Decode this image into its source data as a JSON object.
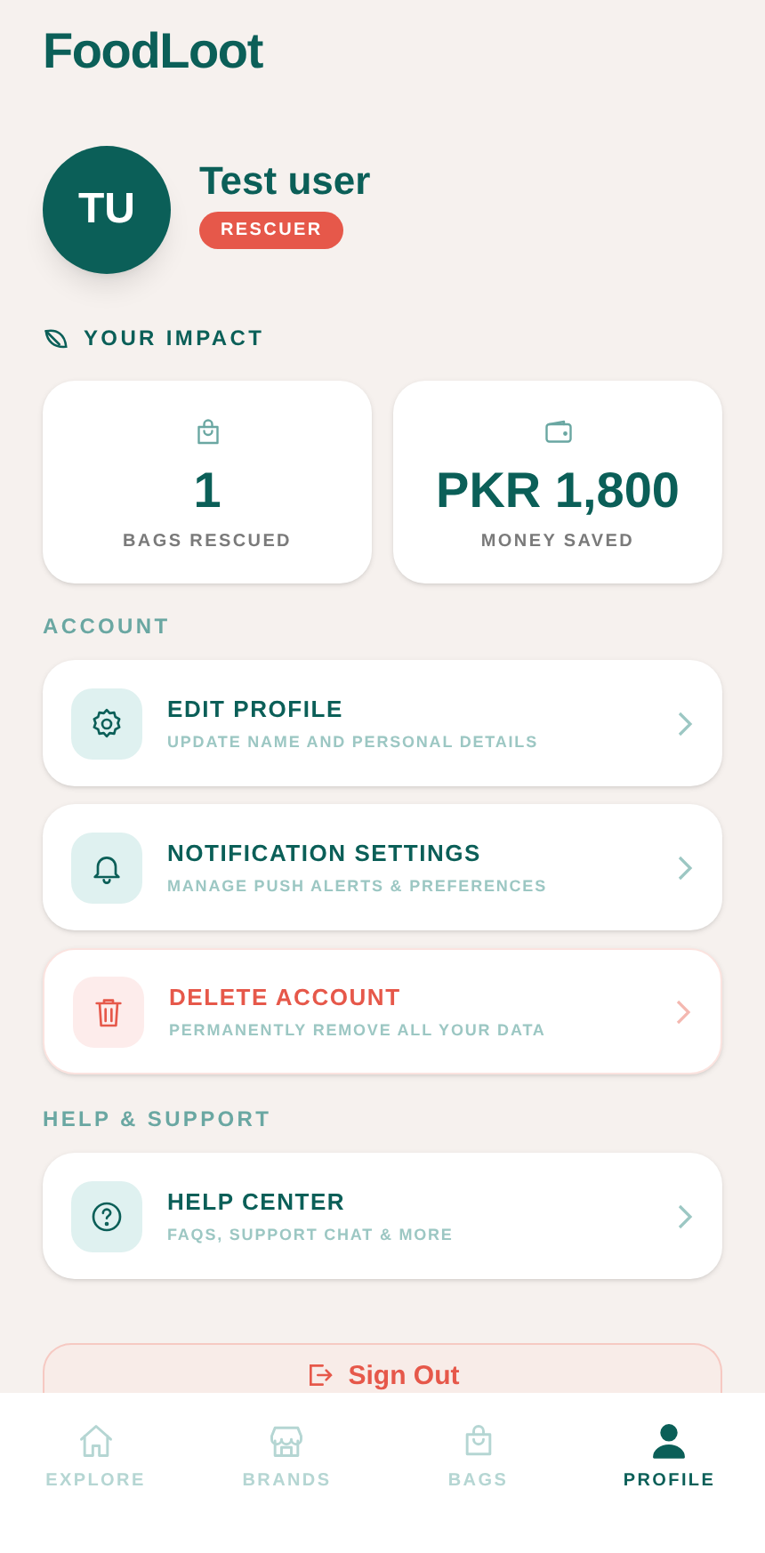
{
  "app_title": "FoodLoot",
  "profile": {
    "initials": "TU",
    "name": "Test user",
    "badge": "RESCUER"
  },
  "impact": {
    "title": "YOUR IMPACT",
    "stats": [
      {
        "value": "1",
        "label": "BAGS RESCUED"
      },
      {
        "value": "PKR 1,800",
        "label": "MONEY SAVED"
      }
    ]
  },
  "sections": [
    {
      "title": "ACCOUNT",
      "items": [
        {
          "kind": "normal",
          "title": "EDIT PROFILE",
          "subtitle": "UPDATE NAME AND PERSONAL DETAILS"
        },
        {
          "kind": "normal",
          "title": "NOTIFICATION SETTINGS",
          "subtitle": "MANAGE PUSH ALERTS & PREFERENCES"
        },
        {
          "kind": "danger",
          "title": "DELETE ACCOUNT",
          "subtitle": "PERMANENTLY REMOVE ALL YOUR DATA"
        }
      ]
    },
    {
      "title": "HELP & SUPPORT",
      "items": [
        {
          "kind": "normal",
          "title": "HELP CENTER",
          "subtitle": "FAQS, SUPPORT CHAT & MORE"
        }
      ]
    }
  ],
  "sign_out": "Sign Out",
  "nav": [
    {
      "label": "EXPLORE",
      "selected": false
    },
    {
      "label": "BRANDS",
      "selected": false
    },
    {
      "label": "BAGS",
      "selected": false
    },
    {
      "label": "PROFILE",
      "selected": true
    }
  ]
}
